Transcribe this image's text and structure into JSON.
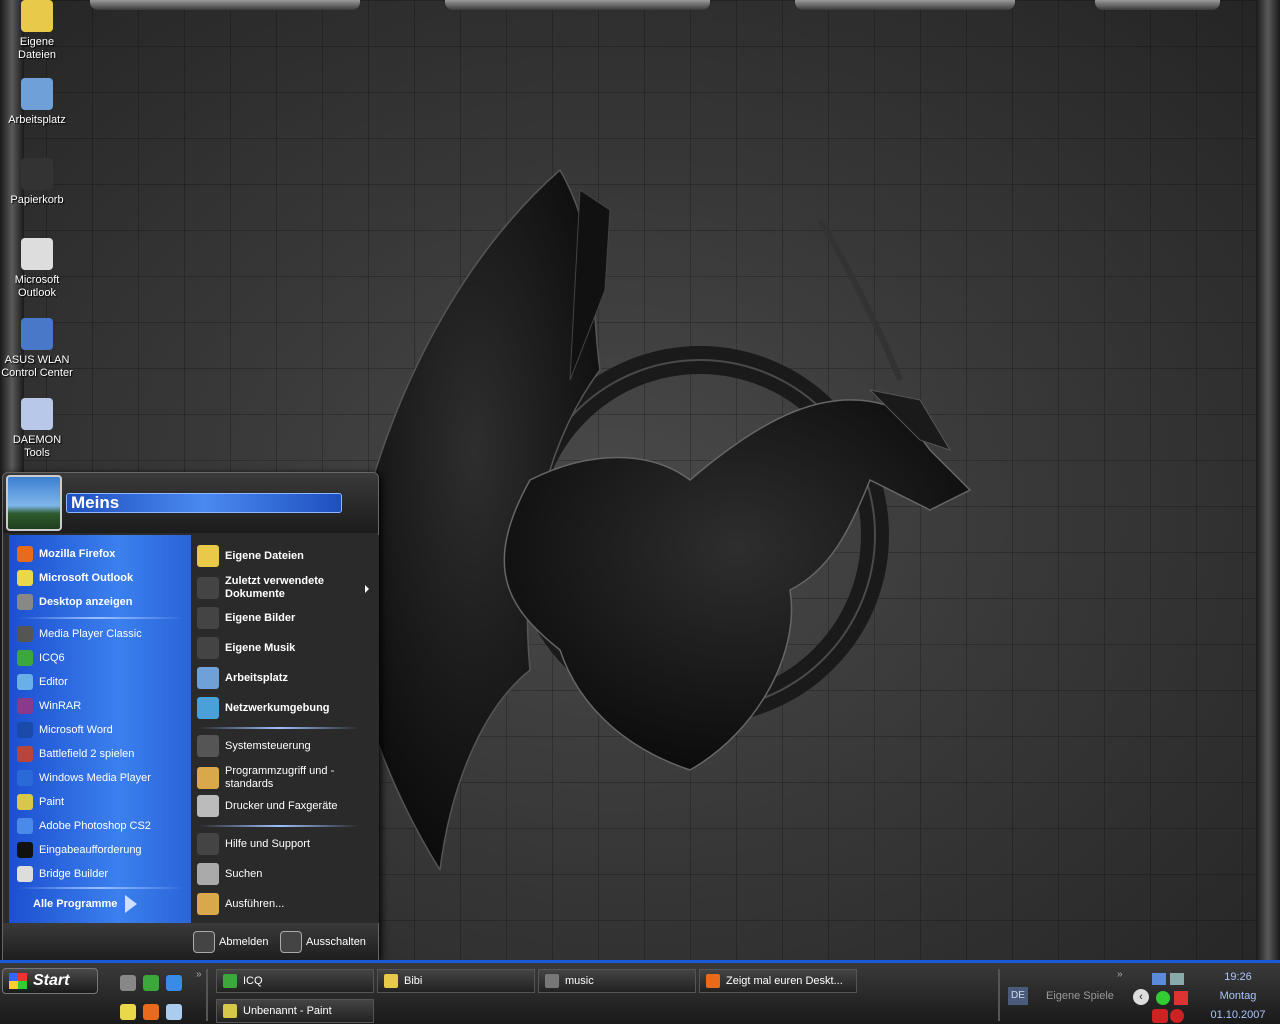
{
  "desktop": {
    "icons": [
      {
        "label": "Eigene Dateien",
        "icon": "folder-icon",
        "color": "#e8c94a"
      },
      {
        "label": "Arbeitsplatz",
        "icon": "computer-icon",
        "color": "#6fa0d8"
      },
      {
        "label": "Papierkorb",
        "icon": "recycle-bin-icon",
        "color": "#333333"
      },
      {
        "label": "Microsoft Outlook",
        "icon": "outlook-icon",
        "color": "#dddddd"
      },
      {
        "label": "ASUS WLAN Control Center",
        "icon": "wlan-icon",
        "color": "#4a78c8"
      },
      {
        "label": "DAEMON Tools",
        "icon": "daemon-tools-icon",
        "color": "#b8c8e8"
      }
    ]
  },
  "start_menu": {
    "user": "Meins",
    "pinned": [
      {
        "label": "Mozilla Firefox",
        "icon": "firefox-icon",
        "color": "#e86a1a"
      },
      {
        "label": "Microsoft Outlook",
        "icon": "outlook-icon",
        "color": "#e8d84a"
      },
      {
        "label": "Desktop anzeigen",
        "icon": "desktop-icon",
        "color": "#888888"
      }
    ],
    "recent": [
      {
        "label": "Media Player Classic",
        "icon": "media-player-classic-icon",
        "color": "#555555"
      },
      {
        "label": "ICQ6",
        "icon": "icq-icon",
        "color": "#3ca83c"
      },
      {
        "label": "Editor",
        "icon": "notepad-icon",
        "color": "#6ab0e8"
      },
      {
        "label": "WinRAR",
        "icon": "winrar-icon",
        "color": "#8a3a8a"
      },
      {
        "label": "Microsoft Word",
        "icon": "word-icon",
        "color": "#1a4aaa"
      },
      {
        "label": "Battlefield 2 spielen",
        "icon": "battlefield-icon",
        "color": "#b8443a"
      },
      {
        "label": "Windows Media Player",
        "icon": "wmp-icon",
        "color": "#2a6ad8"
      },
      {
        "label": "Paint",
        "icon": "paint-icon",
        "color": "#d8c84a"
      },
      {
        "label": "Adobe Photoshop CS2",
        "icon": "photoshop-icon",
        "color": "#4a8ae8"
      },
      {
        "label": "Eingabeaufforderung",
        "icon": "cmd-icon",
        "color": "#111111"
      },
      {
        "label": "Bridge Builder",
        "icon": "bridge-builder-icon",
        "color": "#dddddd"
      }
    ],
    "all_programs": "Alle Programme",
    "places": [
      {
        "label": "Eigene Dateien",
        "icon": "folder-icon",
        "color": "#e8c94a",
        "bold": true
      },
      {
        "label": "Zuletzt verwendete Dokumente",
        "icon": "recent-docs-icon",
        "color": "#444444",
        "bold": true
      },
      {
        "label": "Eigene Bilder",
        "icon": "pictures-icon",
        "color": "#444444",
        "bold": true
      },
      {
        "label": "Eigene Musik",
        "icon": "music-icon",
        "color": "#444444",
        "bold": true
      },
      {
        "label": "Arbeitsplatz",
        "icon": "computer-icon",
        "color": "#6fa0d8",
        "bold": true
      },
      {
        "label": "Netzwerkumgebung",
        "icon": "network-icon",
        "color": "#4aa0d8",
        "bold": true
      }
    ],
    "system": [
      {
        "label": "Systemsteuerung",
        "icon": "control-panel-icon",
        "color": "#555555"
      },
      {
        "label": "Programmzugriff und -standards",
        "icon": "program-access-icon",
        "color": "#d8a84a"
      },
      {
        "label": "Drucker und Faxgeräte",
        "icon": "printer-icon",
        "color": "#bbbbbb"
      }
    ],
    "help": [
      {
        "label": "Hilfe und Support",
        "icon": "help-icon",
        "color": "#444444"
      },
      {
        "label": "Suchen",
        "icon": "search-icon",
        "color": "#aaaaaa"
      },
      {
        "label": "Ausführen...",
        "icon": "run-icon",
        "color": "#d8a84a"
      }
    ],
    "logoff": "Abmelden",
    "shutdown": "Ausschalten"
  },
  "taskbar": {
    "start": "Start",
    "quicklaunch": [
      {
        "icon": "show-desktop-icon",
        "color": "#888888"
      },
      {
        "icon": "icq-icon",
        "color": "#3ca83c"
      },
      {
        "icon": "ie-icon",
        "color": "#3a8ae8"
      },
      {
        "icon": "outlook-icon",
        "color": "#e8d84a"
      },
      {
        "icon": "firefox-icon",
        "color": "#e86a1a"
      },
      {
        "icon": "notepad-icon",
        "color": "#aaccee"
      }
    ],
    "tasks": [
      {
        "label": "ICQ",
        "icon": "icq-icon",
        "color": "#3ca83c"
      },
      {
        "label": "Bibi",
        "icon": "folder-icon",
        "color": "#e8c94a"
      },
      {
        "label": "music",
        "icon": "window-icon",
        "color": "#777777"
      },
      {
        "label": "Zeigt mal euren Deskt...",
        "icon": "firefox-icon",
        "color": "#e86a1a"
      },
      {
        "label": "Unbenannt - Paint",
        "icon": "paint-icon",
        "color": "#d8c84a"
      }
    ],
    "language": "DE",
    "toolbar_label": "Eigene Spiele",
    "time": "19:26",
    "day": "Montag",
    "date": "01.10.2007"
  }
}
